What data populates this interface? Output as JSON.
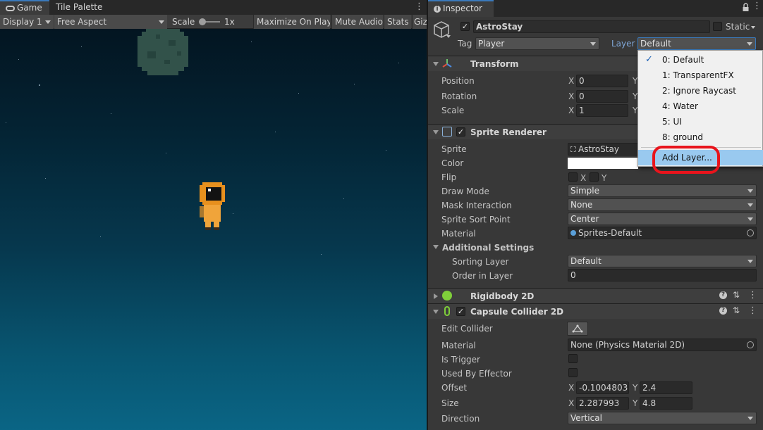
{
  "game": {
    "tabs": [
      {
        "label": "Game"
      },
      {
        "label": "Tile Palette"
      }
    ],
    "toolbar": {
      "display": "Display 1",
      "aspect": "Free Aspect",
      "scale_label": "Scale",
      "scale_value": "1x",
      "maximize": "Maximize On Play",
      "mute": "Mute Audio",
      "stats": "Stats",
      "gizmos": "Giz"
    }
  },
  "inspector": {
    "tab": "Inspector",
    "object": {
      "name": "AstroStay",
      "static_label": "Static",
      "tag_label": "Tag",
      "tag_value": "Player",
      "layer_label": "Layer",
      "layer_value": "Default"
    },
    "transform": {
      "title": "Transform",
      "rows": [
        {
          "label": "Position",
          "x": "0"
        },
        {
          "label": "Rotation",
          "x": "0"
        },
        {
          "label": "Scale",
          "x": "1"
        }
      ],
      "x_axis": "X",
      "y_axis": "Y"
    },
    "sprite_renderer": {
      "title": "Sprite Renderer",
      "sprite_label": "Sprite",
      "sprite_value": "AstroStay",
      "color_label": "Color",
      "flip_label": "Flip",
      "flip_x": "X",
      "flip_y": "Y",
      "draw_mode_label": "Draw Mode",
      "draw_mode_value": "Simple",
      "mask_label": "Mask Interaction",
      "mask_value": "None",
      "sort_point_label": "Sprite Sort Point",
      "sort_point_value": "Center",
      "material_label": "Material",
      "material_value": "Sprites-Default",
      "additional_title": "Additional Settings",
      "sorting_layer_label": "Sorting Layer",
      "sorting_layer_value": "Default",
      "order_label": "Order in Layer",
      "order_value": "0"
    },
    "rigidbody": {
      "title": "Rigidbody 2D"
    },
    "capsule": {
      "title": "Capsule Collider 2D",
      "edit_label": "Edit Collider",
      "material_label": "Material",
      "material_value": "None (Physics Material 2D)",
      "trigger_label": "Is Trigger",
      "effector_label": "Used By Effector",
      "offset_label": "Offset",
      "offset_x": "-0.1004803",
      "offset_y": "2.4",
      "size_label": "Size",
      "size_x": "2.287993",
      "size_y": "4.8",
      "direction_label": "Direction",
      "direction_value": "Vertical"
    }
  },
  "layer_menu": {
    "items": [
      {
        "label": "0: Default",
        "checked": true
      },
      {
        "label": "1: TransparentFX"
      },
      {
        "label": "2: Ignore Raycast"
      },
      {
        "label": "4: Water"
      },
      {
        "label": "5: UI"
      },
      {
        "label": "8: ground"
      }
    ],
    "add_layer": "Add Layer...",
    "highlight_color": "#e8141c"
  }
}
